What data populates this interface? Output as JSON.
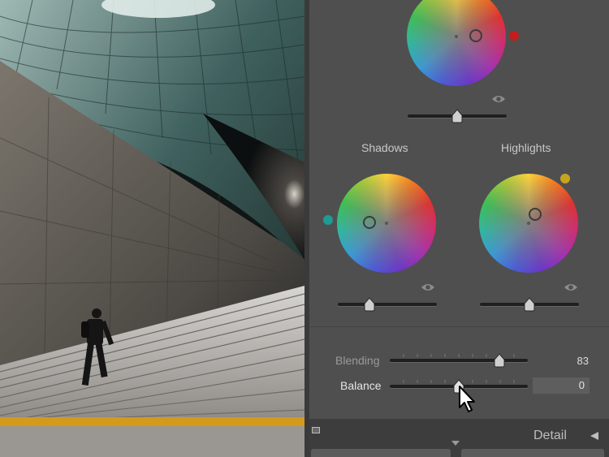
{
  "color_grading": {
    "midtones_wheel": {
      "hue_color": "#c41d1d"
    },
    "shadows": {
      "label": "Shadows",
      "hue_color": "#1e9b95"
    },
    "highlights": {
      "label": "Highlights",
      "hue_color": "#c8a320"
    },
    "blending": {
      "label": "Blending",
      "value": "83"
    },
    "balance": {
      "label": "Balance",
      "value": "0"
    }
  },
  "detail_section": {
    "label": "Detail"
  },
  "icons": [
    "eye-icon",
    "cursor-arrow-icon",
    "disclosure-triangle-icon"
  ]
}
